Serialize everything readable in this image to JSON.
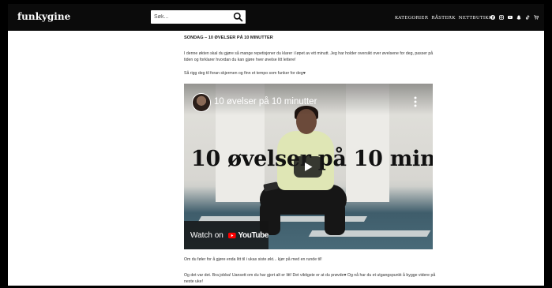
{
  "header": {
    "logo": "funkygine",
    "search_placeholder": "Søk...",
    "nav_links": [
      "KATEGORIER",
      "RÅSTERK",
      "NETTBUTIKK"
    ],
    "icons": [
      "facebook-icon",
      "instagram-icon",
      "youtube-icon",
      "snapchat-icon",
      "tiktok-icon",
      "cart-icon"
    ]
  },
  "post": {
    "title": "SONDAG – 10 ØVELSER PÅ 10 MINUTTER",
    "paragraph_1": "I denne økten skal du gjøre så mange repetisjoner du klarer i løpet av ett minutt. Jeg har holder oversikt over øvelsene for deg, passer på tiden og forklarer hvordan du kan gjøre hver øvelse litt lettere!",
    "paragraph_2": "Så rigg deg til foran skjermen og finn et tempo som funker for deg♥",
    "paragraph_3": "Om du føler for å gjøre enda litt til i ukas siste økt... kjør på med en runde til!",
    "paragraph_4": "Og det var det. Bra jobba! Uansett om du har gjort alt er litt! Det viktigste er at du prøvde♥ Og nå har du et utgangspunkt å bygge videre på neste uke!"
  },
  "video": {
    "title": "10 øvelser på 10 minutter",
    "overlay_title": "10 øvelser på 10 minutter",
    "watch_on": "Watch on",
    "youtube_label": "YouTube"
  },
  "colors": {
    "navbar": "#0b0b0b",
    "youtube_red": "#ff0000"
  }
}
